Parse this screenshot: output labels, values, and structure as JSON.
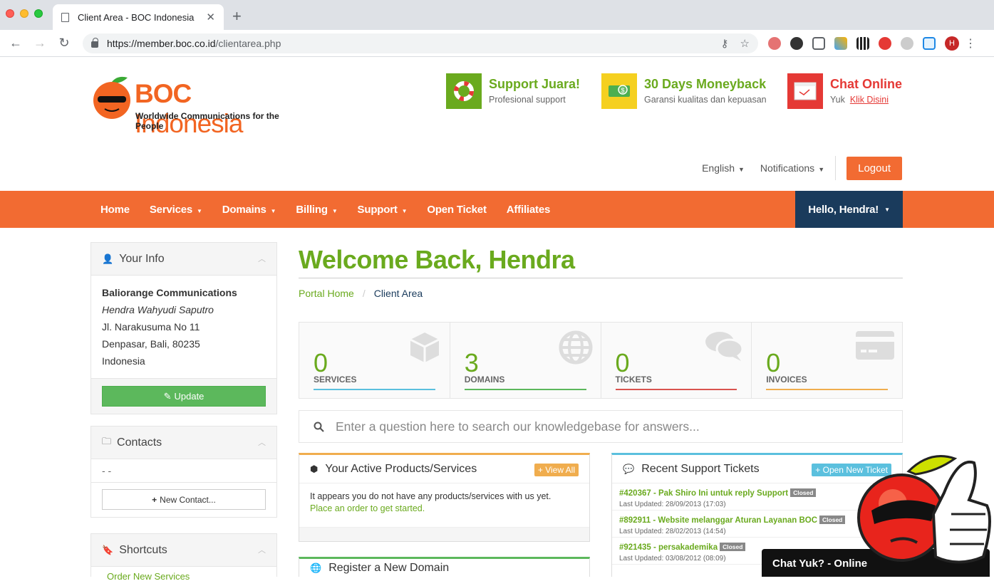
{
  "browser": {
    "tab_title": "Client Area - BOC Indonesia",
    "url_host": "https://member.boc.co.id",
    "url_path": "/clientarea.php"
  },
  "header": {
    "logo_brand": "BOC",
    "logo_name": "Indonesia",
    "logo_tagline": "Worldwide Communications for the People",
    "promos": [
      {
        "title": "Support Juara!",
        "subtitle": "Profesional support",
        "color": "#6aaa1e",
        "box_color": "#6aaa1e"
      },
      {
        "title": "30 Days Moneyback",
        "subtitle": "Garansi kualitas dan kepuasan",
        "color": "#6aaa1e",
        "box_color": "#f5d020"
      },
      {
        "title": "Chat Online",
        "subtitle_prefix": "Yuk",
        "subtitle_link": "Klik Disini",
        "color": "#e53935",
        "box_color": "#e53935"
      }
    ],
    "language": "English",
    "notifications": "Notifications",
    "logout": "Logout"
  },
  "nav": {
    "items": [
      "Home",
      "Services",
      "Domains",
      "Billing",
      "Support",
      "Open Ticket",
      "Affiliates"
    ],
    "hello": "Hello, Hendra!"
  },
  "sidebar": {
    "your_info": {
      "title": "Your Info",
      "company": "Baliorange Communications",
      "name": "Hendra Wahyudi Saputro",
      "address1": "Jl. Narakusuma No 11",
      "address2": "Denpasar, Bali, 80235",
      "country": "Indonesia",
      "update_btn": "Update"
    },
    "contacts": {
      "title": "Contacts",
      "empty": "- -",
      "new_btn": "New Contact..."
    },
    "shortcuts": {
      "title": "Shortcuts",
      "first_item": "Order New Services"
    }
  },
  "main": {
    "welcome": "Welcome Back, Hendra",
    "breadcrumb_home": "Portal Home",
    "breadcrumb_current": "Client Area",
    "tiles": [
      {
        "value": "0",
        "label": "SERVICES",
        "color": "#5bc0de"
      },
      {
        "value": "3",
        "label": "DOMAINS",
        "color": "#5cb85c"
      },
      {
        "value": "0",
        "label": "TICKETS",
        "color": "#d9534f"
      },
      {
        "value": "0",
        "label": "INVOICES",
        "color": "#f0ad4e"
      }
    ],
    "kb_placeholder": "Enter a question here to search our knowledgebase for answers...",
    "products": {
      "title": "Your Active Products/Services",
      "view_all": "View All",
      "empty_text": "It appears you do not have any products/services with us yet.",
      "order_link": "Place an order to get started."
    },
    "tickets": {
      "title": "Recent Support Tickets",
      "open_btn": "Open New Ticket",
      "list": [
        {
          "title": "#420367 - Pak Shiro Ini untuk reply Support",
          "status": "Closed",
          "updated": "Last Updated: 28/09/2013 (17:03)"
        },
        {
          "title": "#892911 - Website melanggar Aturan Layanan BOC",
          "status": "Closed",
          "updated": "Last Updated: 28/02/2013 (14:54)"
        },
        {
          "title": "#921435 - persakademika",
          "status": "Closed",
          "updated": "Last Updated: 03/08/2012 (08:09)"
        }
      ]
    },
    "domain_card_title": "Register a New Domain"
  },
  "chat": {
    "label": "Chat Yuk? - Online"
  }
}
